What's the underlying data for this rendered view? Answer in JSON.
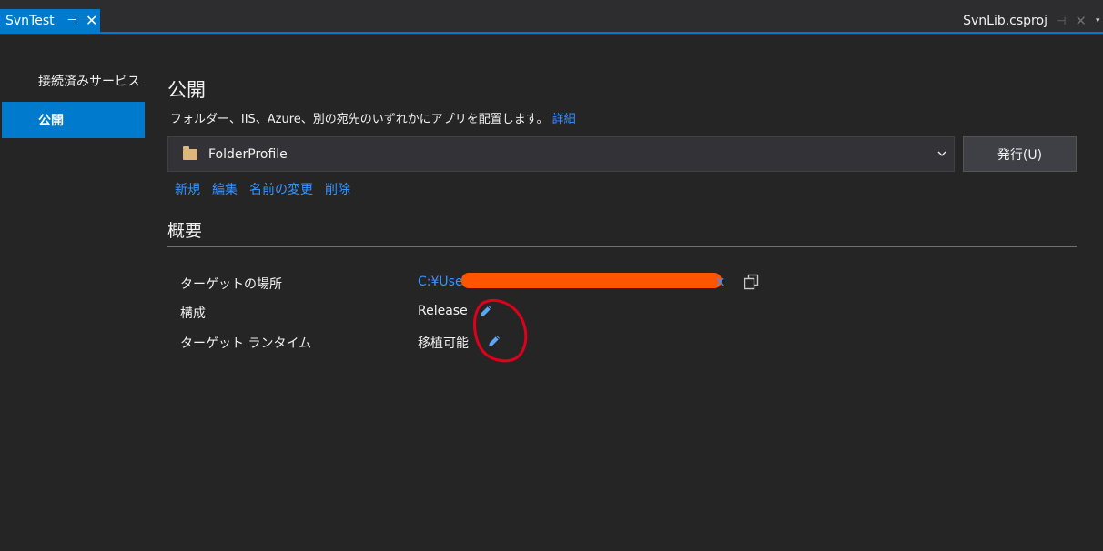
{
  "tabs": {
    "active": {
      "label": "SvnTest",
      "pin": "⊣",
      "close": "✕"
    },
    "right": {
      "label": "SvnLib.csproj",
      "pin": "⊣",
      "close": "✕",
      "dropdown": "▾"
    }
  },
  "sidebar": {
    "items": [
      {
        "label": "接続済みサービス",
        "selected": false
      },
      {
        "label": "公開",
        "selected": true
      }
    ]
  },
  "main": {
    "title": "公開",
    "description": "フォルダー、IIS、Azure、別の宛先のいずれかにアプリを配置します。",
    "details_link": "詳細",
    "profile": {
      "name": "FolderProfile",
      "icon": "folder-icon"
    },
    "publish_button": "発行(U)",
    "actions": [
      "新規",
      "編集",
      "名前の変更",
      "削除"
    ],
    "summary": {
      "title": "概要",
      "rows": [
        {
          "label": "ターゲットの場所",
          "value": "C:¥User",
          "value_tail": "x"
        },
        {
          "label": "構成",
          "value": "Release"
        },
        {
          "label": "ターゲット ランタイム",
          "value": "移植可能"
        }
      ]
    }
  },
  "colors": {
    "accent": "#007acc",
    "link": "#3794ff",
    "background": "#252526",
    "annotation": "#e0001b",
    "redaction": "#ff5500"
  }
}
